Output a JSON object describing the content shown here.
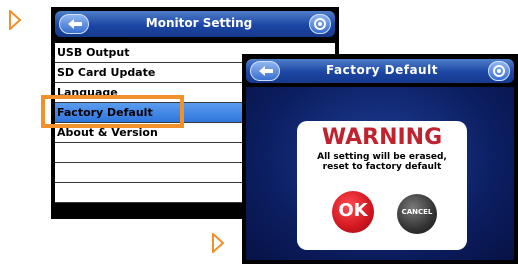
{
  "colors": {
    "accent_orange": "#f0912b",
    "titlebar_blue": "#1c46a4",
    "selected_blue": "#3a85e6",
    "warning_red": "#c0232e",
    "ok_red": "#d0161f"
  },
  "monitor_setting": {
    "title": "Monitor Setting",
    "back_icon": "back-arrow-icon",
    "settings_icon": "gear-icon",
    "items": [
      {
        "label": "USB Output"
      },
      {
        "label": "SD Card Update"
      },
      {
        "label": "Language"
      },
      {
        "label": "Factory Default"
      },
      {
        "label": "About & Version"
      },
      {
        "label": ""
      },
      {
        "label": ""
      },
      {
        "label": ""
      }
    ],
    "selected_item": "Factory Default"
  },
  "factory_default": {
    "title": "Factory Default",
    "back_icon": "back-arrow-icon",
    "settings_icon": "gear-icon",
    "dialog": {
      "heading": "WARNING",
      "message_line1": "All setting will be erased,",
      "message_line2": "reset to factory default",
      "ok_label": "OK",
      "cancel_label": "CANCEL"
    }
  }
}
